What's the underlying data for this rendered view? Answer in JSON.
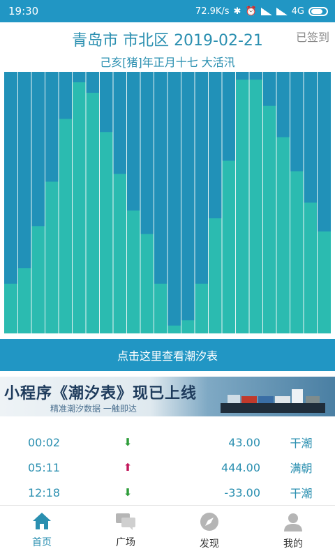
{
  "status": {
    "time": "19:30",
    "speed": "72.9K/s",
    "network": "4G"
  },
  "header": {
    "title": "青岛市 市北区 2019-02-21",
    "checkin": "已签到",
    "lunar": "己亥[猪]年正月十七 大活汛"
  },
  "chart_data": {
    "type": "bar",
    "values": [
      0.19,
      0.25,
      0.41,
      0.58,
      0.82,
      0.96,
      0.92,
      0.77,
      0.61,
      0.47,
      0.38,
      0.19,
      0.03,
      0.05,
      0.19,
      0.44,
      0.66,
      0.97,
      0.97,
      0.87,
      0.75,
      0.62,
      0.5,
      0.39
    ],
    "ylim": [
      0,
      1
    ],
    "colors": {
      "fill": "#2bbbb0",
      "background": "#2191b8",
      "divider": "#e8f4f4"
    }
  },
  "tide_button": "点击这里查看潮汐表",
  "banner": {
    "title": "小程序《潮汐表》现已上线",
    "subtitle": "精准潮汐数据 一触即达"
  },
  "tides": [
    {
      "time": "00:02",
      "dir": "down",
      "height": "43.00",
      "status": "干潮"
    },
    {
      "time": "05:11",
      "dir": "up",
      "height": "444.00",
      "status": "满朝"
    },
    {
      "time": "12:18",
      "dir": "down",
      "height": "-33.00",
      "status": "干潮"
    }
  ],
  "arrows": {
    "up": "⬆",
    "down": "⬇",
    "up_color": "#c2185b",
    "down_color": "#2e9d3a"
  },
  "tabs": [
    {
      "label": "首页",
      "icon": "home-icon"
    },
    {
      "label": "广场",
      "icon": "chat-icon"
    },
    {
      "label": "发现",
      "icon": "compass-icon"
    },
    {
      "label": "我的",
      "icon": "user-icon"
    }
  ]
}
